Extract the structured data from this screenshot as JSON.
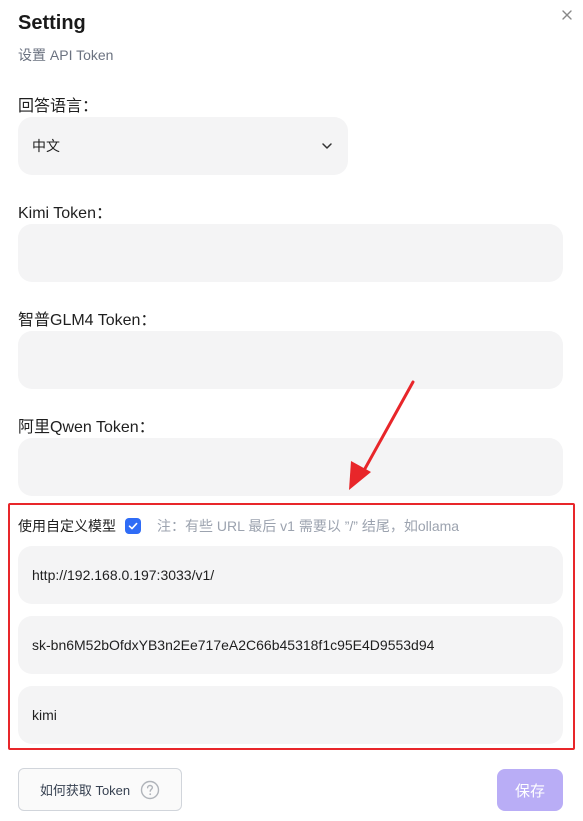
{
  "header": {
    "title": "Setting",
    "subtitle": "设置 API Token"
  },
  "language": {
    "label": "回答语言：",
    "selected": "中文"
  },
  "kimi": {
    "label": "Kimi Token：",
    "value": ""
  },
  "glm": {
    "label": "智普GLM4 Token：",
    "value": ""
  },
  "qwen": {
    "label": "阿里Qwen Token：",
    "value": ""
  },
  "custom_model": {
    "label": "使用自定义模型",
    "checked": true,
    "note": "注：有些 URL 最后 v1 需要以 ”/” 结尾，如ollama",
    "url": "http://192.168.0.197:3033/v1/",
    "api_key": "sk-bn6M52bOfdxYB3n2Ee717eA2C66b45318f1c95E4D9553d94",
    "model": "kimi"
  },
  "footer": {
    "help_label": "如何获取 Token",
    "save_label": "保存"
  },
  "colors": {
    "accent": "#2f6cf6",
    "save": "#b9adf6",
    "highlight": "#e8262a"
  }
}
